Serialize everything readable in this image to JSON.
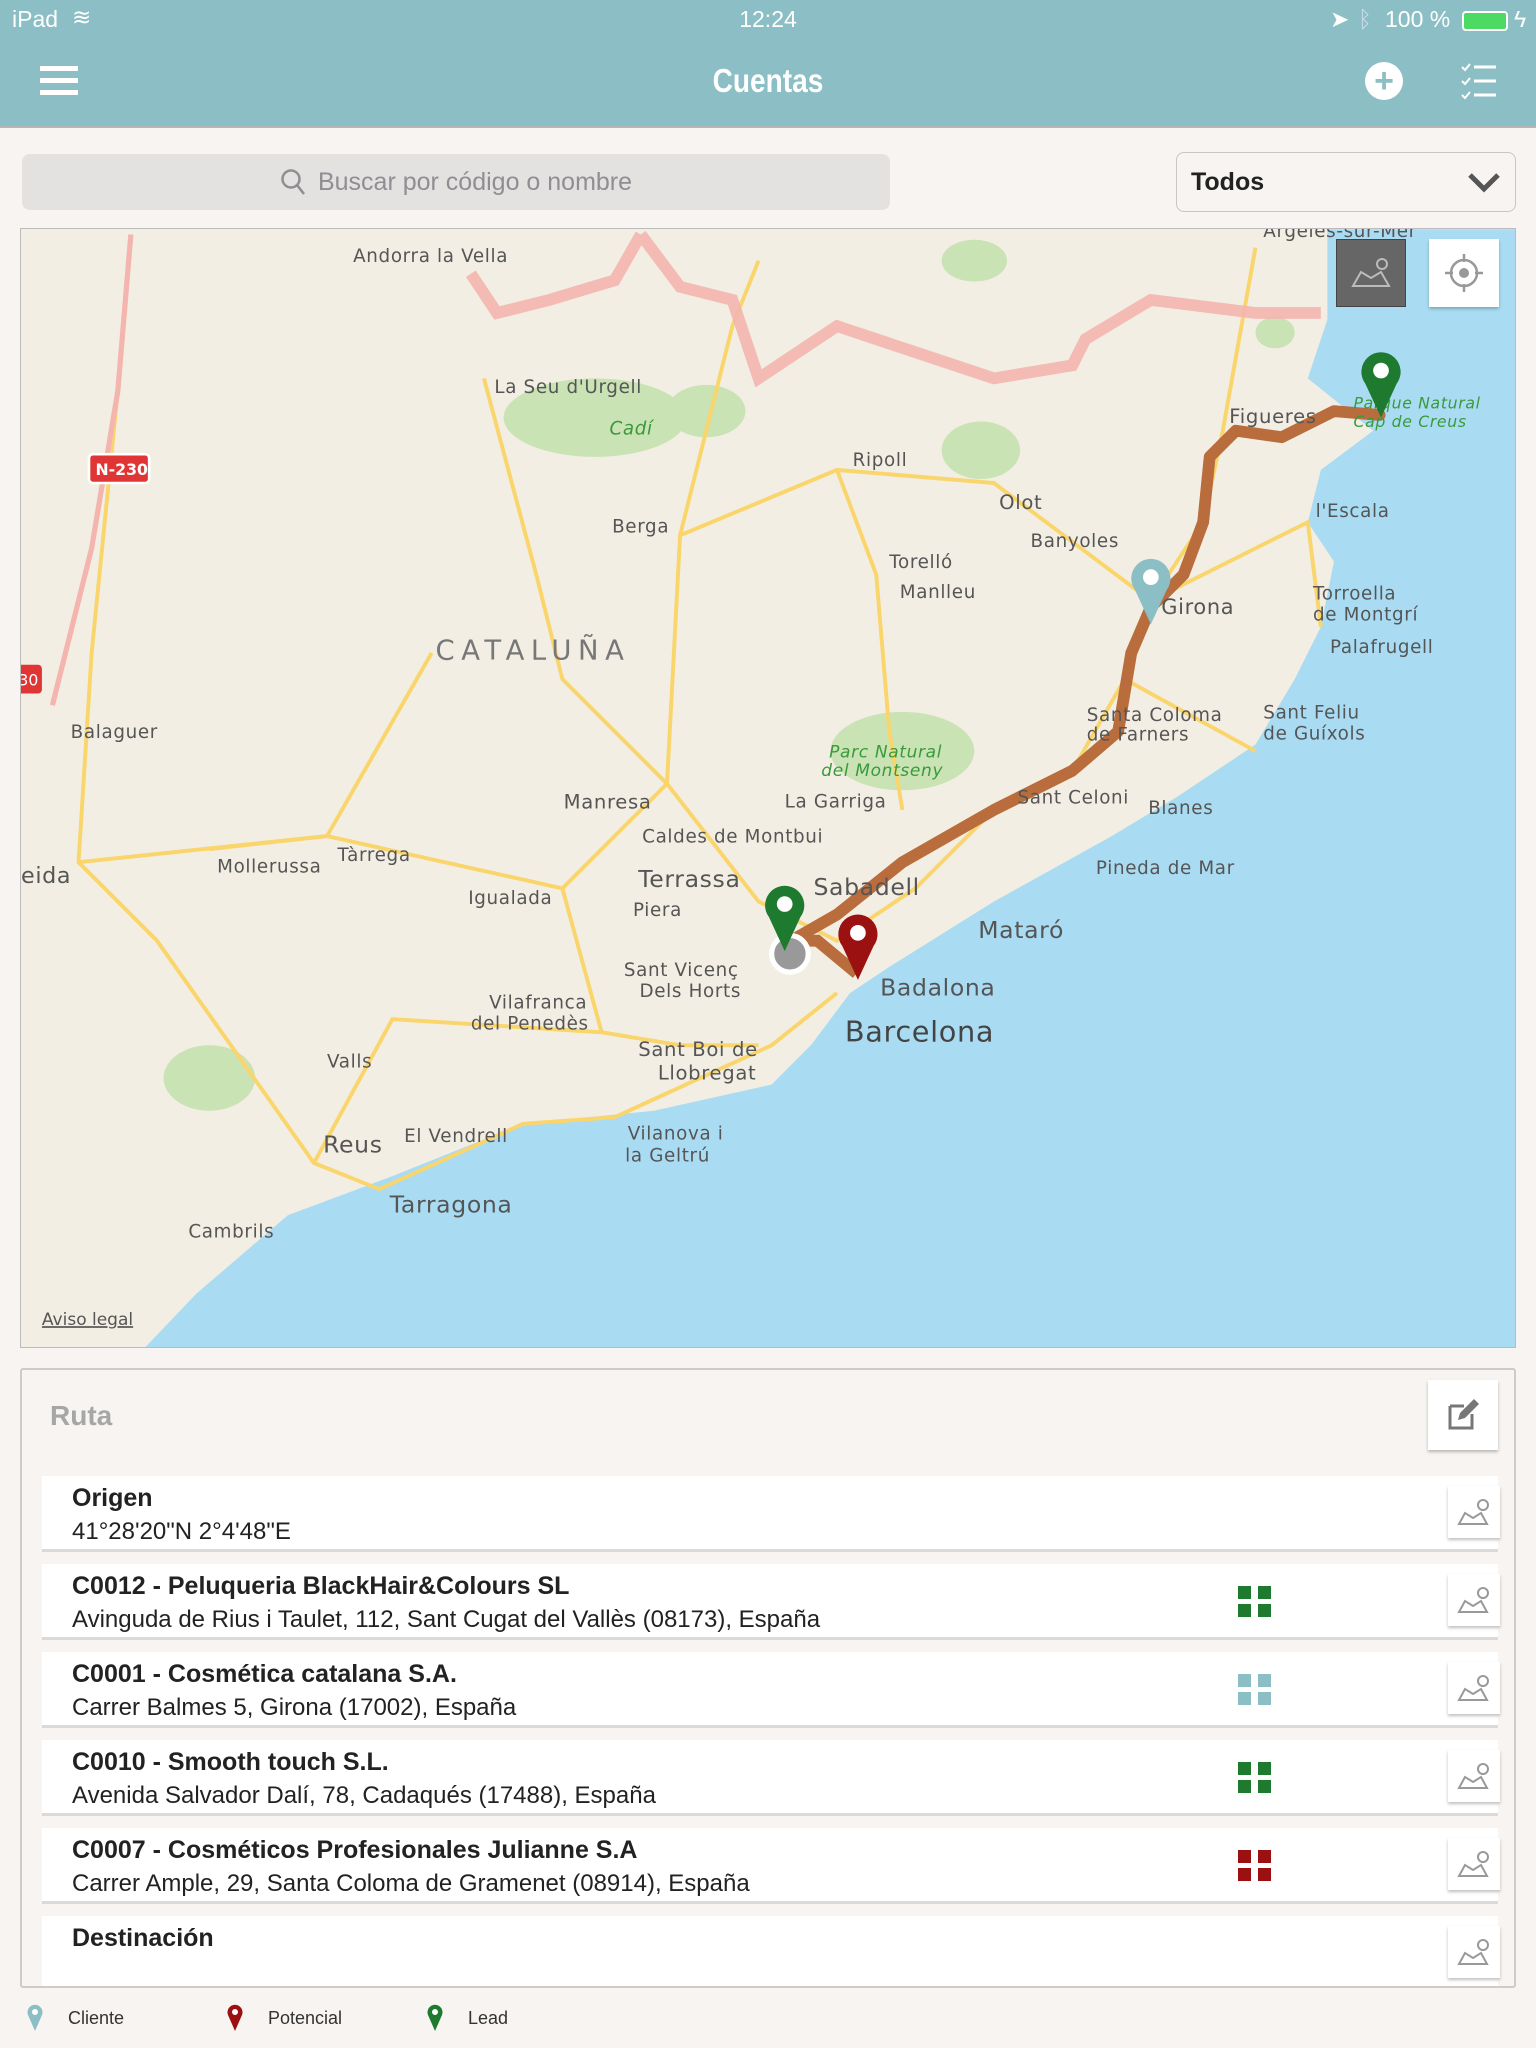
{
  "status": {
    "device": "iPad",
    "time": "12:24",
    "battery": "100 %"
  },
  "header": {
    "title": "Cuentas",
    "menu_icon": "hamburger-icon",
    "add_icon": "plus-circle-icon",
    "list_icon": "checklist-icon",
    "color": "#8cbec5"
  },
  "search": {
    "placeholder": "Buscar por código o nombre"
  },
  "filter": {
    "selected": "Todos"
  },
  "map": {
    "labels": {
      "andorra": "Andorra la Vella",
      "seu": "La Seu d'Urgell",
      "cadi": "Cadí",
      "ripoll": "Ripoll",
      "olot": "Olot",
      "banyoles": "Banyoles",
      "berga": "Berga",
      "torello": "Torelló",
      "manlleu": "Manlleu",
      "figueres": "Figueres",
      "escala": "l'Escala",
      "torroella": [
        "Torroella",
        "de Montgrí"
      ],
      "girona": "Girona",
      "palafrugell": "Palafrugell",
      "cataluna": "CATALUÑA",
      "balaguer": "Balaguer",
      "scoloma": [
        "Santa Coloma",
        "de Farners"
      ],
      "sfeliu": [
        "Sant Feliu",
        "de Guíxols"
      ],
      "montseny": [
        "Parc Natural",
        "del Montseny"
      ],
      "manresa": "Manresa",
      "garriga": "La Garriga",
      "celoni": "Sant Celoni",
      "blanes": "Blanes",
      "caldes": "Caldes de Montbui",
      "pineda": "Pineda de Mar",
      "mollerussa": "Mollerussa",
      "tarrega": "Tàrrega",
      "lleida": "eida",
      "igualada": "Igualada",
      "terrassa": "Terrassa",
      "sabadell": "Sabadell",
      "piera": "Piera",
      "mataro": "Mataró",
      "svicenc": [
        "Sant Vicenç",
        "Dels Horts"
      ],
      "badalona": "Badalona",
      "vilafranca": [
        "Vilafranca",
        "del Penedès"
      ],
      "barcelona": "Barcelona",
      "sboi": [
        "Sant Boi de",
        "Llobregat"
      ],
      "valls": "Valls",
      "vendrell": "El Vendrell",
      "vilanova": [
        "Vilanova i",
        "la Geltrú"
      ],
      "reus": "Reus",
      "tarragona": "Tarragona",
      "cambrils": "Cambrils",
      "argeles": "Argeles-sur-Mer",
      "capcreus": [
        "Parque Natural",
        "Cap de Creus"
      ],
      "n230": "N-230",
      "n230b": "30",
      "aviso": "Aviso legal"
    },
    "route_color": "#b96c3c",
    "land": "#f3eee3",
    "sea": "#a9dcf3"
  },
  "ruta": {
    "title": "Ruta",
    "rows": [
      {
        "title": "Origen",
        "subtitle": "41°28'20\"N 2°4'48\"E"
      },
      {
        "title": "C0012 - Peluqueria BlackHair&Colours SL",
        "subtitle": "Avinguda de Rius i Taulet, 112, Sant Cugat del Vallès (08173), España",
        "type": "Lead",
        "color": "#1e7a2e"
      },
      {
        "title": "C0001 - Cosmética catalana S.A.",
        "subtitle": "Carrer Balmes 5, Girona (17002), España",
        "type": "Cliente",
        "color": "#8cbec5"
      },
      {
        "title": "C0010 - Smooth touch S.L.",
        "subtitle": "Avenida Salvador Dalí, 78, Cadaqués (17488), España",
        "type": "Lead",
        "color": "#1e7a2e"
      },
      {
        "title": "C0007 - Cosméticos Profesionales Julianne S.A",
        "subtitle": "Carrer Ample, 29, Santa Coloma de Gramenet (08914), España",
        "type": "Potencial",
        "color": "#9b1111"
      },
      {
        "title": "Destinación",
        "subtitle": ""
      }
    ]
  },
  "legend": [
    {
      "label": "Cliente",
      "color": "#8cbec5"
    },
    {
      "label": "Potencial",
      "color": "#9b1111"
    },
    {
      "label": "Lead",
      "color": "#1e7a2e"
    }
  ]
}
